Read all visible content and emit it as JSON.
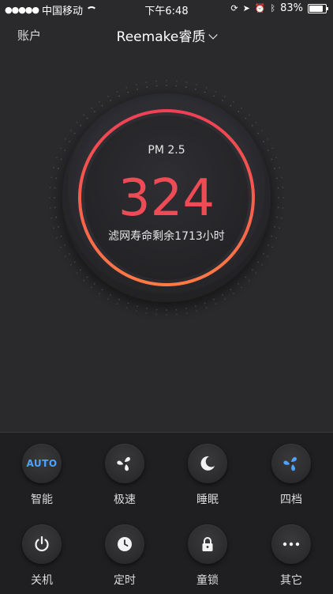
{
  "status_bar": {
    "carrier": "中国移动",
    "time": "下午6:48",
    "battery": "83%",
    "battery_level": 0.83
  },
  "nav": {
    "account": "账户",
    "title": "Reemake睿质"
  },
  "gauge": {
    "label": "PM 2.5",
    "value": "324",
    "filter_text": "滤网寿命剩余1713小时"
  },
  "controls": [
    {
      "label": "智能",
      "icon": "auto-icon",
      "icon_text": "AUTO"
    },
    {
      "label": "极速",
      "icon": "fan-icon"
    },
    {
      "label": "睡眠",
      "icon": "moon-icon"
    },
    {
      "label": "四档",
      "icon": "fan-blue-icon"
    },
    {
      "label": "关机",
      "icon": "power-icon"
    },
    {
      "label": "定时",
      "icon": "clock-icon"
    },
    {
      "label": "童锁",
      "icon": "lock-icon"
    },
    {
      "label": "其它",
      "icon": "more-icon"
    }
  ],
  "colors": {
    "accent_red": "#ef4b56",
    "accent_orange": "#ff7a45",
    "accent_blue": "#4da3ff"
  }
}
